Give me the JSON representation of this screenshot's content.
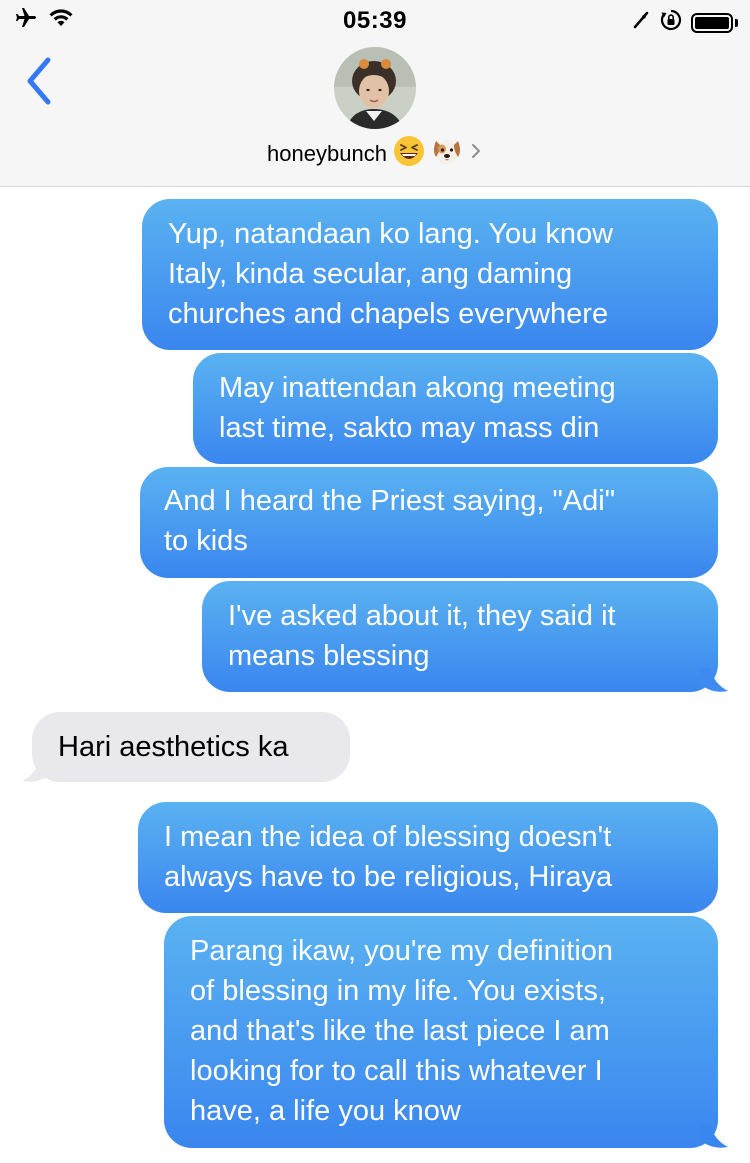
{
  "status_bar": {
    "time": "05:39",
    "left_icons": [
      "airplane-icon",
      "wifi-icon"
    ],
    "right_icons": [
      "location-arrow-icon",
      "orientation-lock-icon",
      "battery-icon"
    ]
  },
  "header": {
    "back_icon": "chevron-left-icon",
    "contact_name": "honeybunch",
    "contact_emojis": [
      "grinning-squinting-face",
      "dog-face"
    ],
    "disclosure_icon": "chevron-right-icon"
  },
  "colors": {
    "sent_top": "#5ab2f1",
    "sent_bottom": "#3a86ef",
    "received": "#e8e8ed",
    "accent": "#3478f6",
    "header_bg": "#f6f6f6"
  },
  "messages": [
    {
      "direction": "sent",
      "text": "Yup, natandaan ko lang. You know\nItaly, kinda secular, ang daming\nchurches and chapels everywhere"
    },
    {
      "direction": "sent",
      "text": "May inattendan akong meeting\nlast time, sakto may mass din"
    },
    {
      "direction": "sent",
      "text": "And I heard the Priest saying, \"Adi\"\nto kids"
    },
    {
      "direction": "sent",
      "text": "I've asked about it, they said it\nmeans blessing"
    },
    {
      "direction": "received",
      "text": "Hari aesthetics ka"
    },
    {
      "direction": "sent",
      "text": "I mean the idea of blessing doesn't\nalways have to be religious, Hiraya"
    },
    {
      "direction": "sent",
      "text": "Parang ikaw, you're my definition\nof blessing in my life. You exists,\nand that's like the last piece I am\nlooking for to call this whatever I\nhave, a life you know"
    }
  ]
}
